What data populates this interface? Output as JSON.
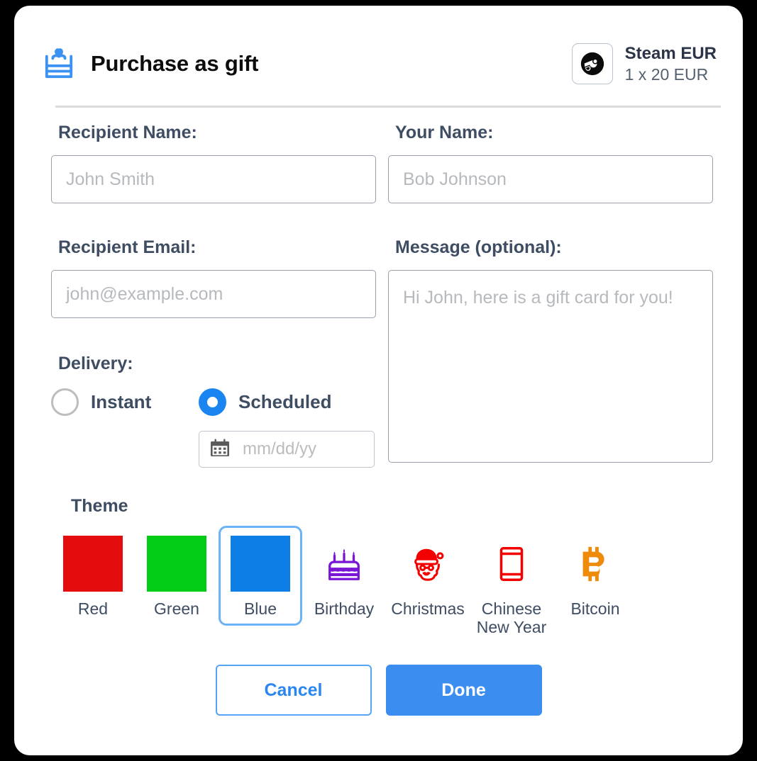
{
  "header": {
    "icon": "gift-card-icon",
    "title": "Purchase as gift",
    "brand": {
      "logo": "steam-logo-icon",
      "name": "Steam EUR",
      "quantity": "1 x 20 EUR"
    }
  },
  "form": {
    "recipient_name": {
      "label": "Recipient Name:",
      "value": "",
      "placeholder": "John Smith"
    },
    "your_name": {
      "label": "Your Name:",
      "value": "",
      "placeholder": "Bob Johnson"
    },
    "recipient_email": {
      "label": "Recipient Email:",
      "value": "",
      "placeholder": "john@example.com"
    },
    "message": {
      "label": "Message (optional):",
      "value": "",
      "placeholder": "Hi John, here is a gift card for you!"
    }
  },
  "delivery": {
    "label": "Delivery:",
    "options": [
      {
        "label": "Instant",
        "selected": false
      },
      {
        "label": "Scheduled",
        "selected": true
      }
    ],
    "date": {
      "icon": "calendar-icon",
      "value": "",
      "placeholder": "mm/dd/yy"
    }
  },
  "theme": {
    "title": "Theme",
    "selected": "Blue",
    "items": [
      {
        "label": "Red",
        "kind": "color",
        "color": "#e40c0c"
      },
      {
        "label": "Green",
        "kind": "color",
        "color": "#03cc14"
      },
      {
        "label": "Blue",
        "kind": "color",
        "color": "#0c7ee6"
      },
      {
        "label": "Birthday",
        "kind": "icon",
        "icon": "birthday-cake-icon",
        "color": "#7b15d6"
      },
      {
        "label": "Christmas",
        "kind": "icon",
        "icon": "santa-claus-icon",
        "color": "#f50000"
      },
      {
        "label": "Chinese New Year",
        "kind": "icon",
        "icon": "red-envelope-icon",
        "color": "#f50000"
      },
      {
        "label": "Bitcoin",
        "kind": "icon",
        "icon": "bitcoin-icon",
        "color": "#ef8b0b"
      }
    ]
  },
  "footer": {
    "cancel_label": "Cancel",
    "done_label": "Done",
    "accent_color": "#3b8ef0"
  }
}
